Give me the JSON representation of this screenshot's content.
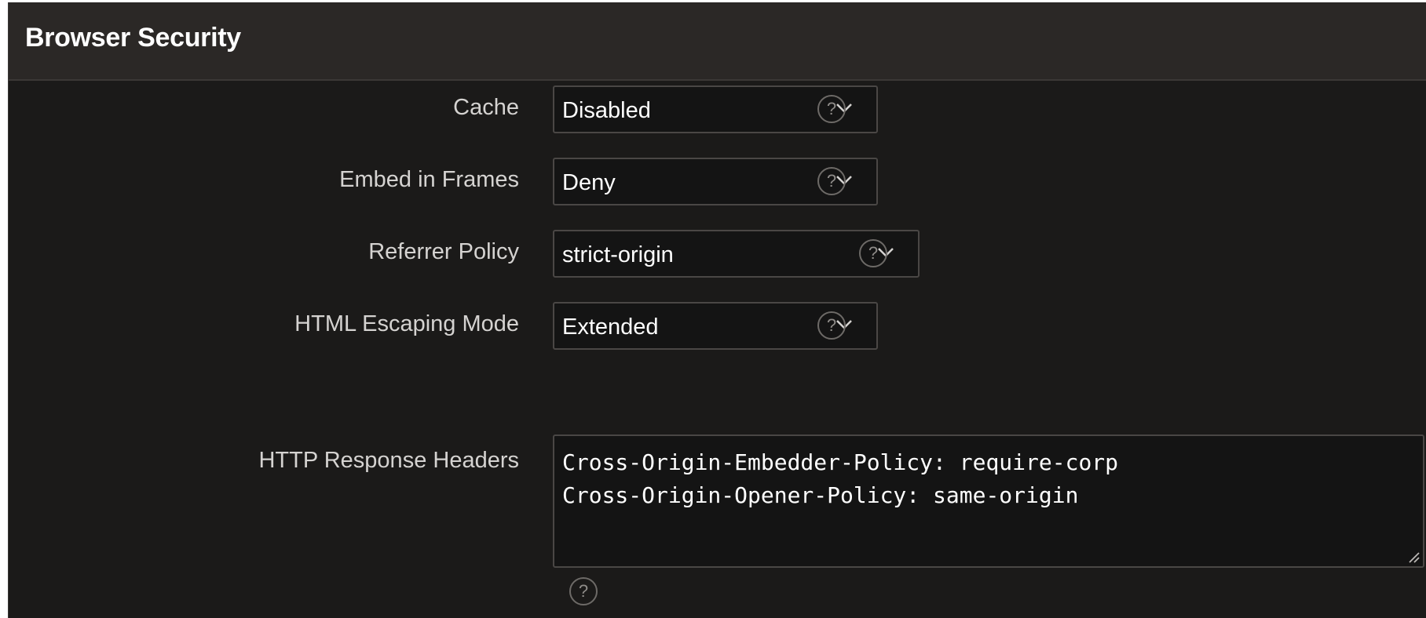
{
  "section": {
    "title": "Browser Security"
  },
  "fields": {
    "cache": {
      "label": "Cache",
      "value": "Disabled"
    },
    "embed_in_frames": {
      "label": "Embed in Frames",
      "value": "Deny"
    },
    "referrer_policy": {
      "label": "Referrer Policy",
      "value": "strict-origin"
    },
    "html_escaping_mode": {
      "label": "HTML Escaping Mode",
      "value": "Extended"
    },
    "http_response_headers": {
      "label": "HTTP Response Headers",
      "lines": [
        "Cross-Origin-Embedder-Policy: require-corp",
        "Cross-Origin-Opener-Policy: same-origin"
      ]
    }
  },
  "help": {
    "symbol": "?"
  },
  "icons": {
    "select_arrow": "chevron-down-icon",
    "help": "help-circle-icon",
    "resize": "resize-handle-icon"
  },
  "colors": {
    "panel_background": "#1b1a19",
    "header_background": "#2b2826",
    "input_background": "#141414",
    "input_border": "#4a4745",
    "label_text": "#d5d3d1"
  }
}
